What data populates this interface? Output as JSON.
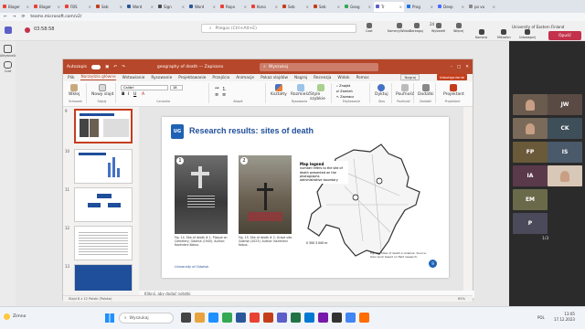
{
  "browser": {
    "tabs": [
      "Bloger",
      "Bloger",
      "FBS",
      "Seb",
      "Word",
      "Sign",
      "Word",
      "Repo",
      "Kono",
      "Seb",
      "Seb",
      "Geog",
      "Tr",
      "Prog",
      "Deep",
      "po vo"
    ],
    "url": "teams.microsoft.com/v2/"
  },
  "teams": {
    "timer": "03:58:58",
    "search_placeholder": "Pliegos (Ctrl+Alt+E)",
    "org": "University of Eastern Finland",
    "left_rail": [
      "Aktywność",
      "Czat"
    ],
    "top_buttons": [
      "Czat",
      "Kamery/Widoki",
      "Zareaguj",
      "Wyświetl",
      "Więcej",
      "Kamera",
      "Mikrofon",
      "Udostępnij"
    ],
    "people_count": "24",
    "leave_label": "Opuść"
  },
  "powerpoint": {
    "autosave": "Autozapis",
    "filename": "geography of death — Zapisano",
    "search": "Wyszukaj",
    "menu": [
      "Plik",
      "Narzędzia główne",
      "Wstawianie",
      "Rysowanie",
      "Projektowanie",
      "Przejścia",
      "Animacje",
      "Pokaz slajdów",
      "Nagraj",
      "Recenzja",
      "Widok",
      "Pomoc"
    ],
    "active_menu": "Narzędzia główne",
    "record_btn": "Nagraj",
    "share_btn": "Udostępnianie",
    "ribbon_groups": [
      "Schowek",
      "Slajdy",
      "Czcionka",
      "Akapit",
      "Rysowanie",
      "Edytowanie",
      "Głos",
      "Poufność",
      "Dodatki",
      "Projektant"
    ],
    "ribbon_buttons": [
      "Wklej",
      "Nowy slajd",
      "Kształty",
      "Rozmieść",
      "Style szybkie",
      "Znajdź",
      "Zamień",
      "Zaznacz",
      "Dyktuj",
      "Poufność",
      "Dodatki",
      "Projektant"
    ],
    "font_name": "Calibri",
    "font_size": "18",
    "notes_placeholder": "Kliknij, aby dodać notatki",
    "status": "Slajd 8 z 12   Polski (Polska)",
    "zoom": "63%"
  },
  "slide": {
    "title": "Research results: sites of death",
    "logo_text": "UG",
    "photo1_num": "1",
    "photo2_num": "2",
    "caption1": "Fig. 14. Site of death # 1. Plaque on Cemetery, Gdańsk (1945). Author: Kazimierz Kobus.",
    "caption2": "Fig. 15. Site of death # 2. Grave site. Gdańsk (2023). Author: Kazimierz Kobus.",
    "legend_title": "Map legend",
    "legend_items": [
      "number refers to the site of death presented on the photographs",
      "administrative boundary"
    ],
    "scale": "0  300  3 000 m",
    "map_caption": "Fig. 16. Sites of death in Gdańsk. Source: Own work based on field research.",
    "footer": "University of Gdańsk",
    "page_num": "9"
  },
  "thumbnails": [
    "9",
    "10",
    "11",
    "12",
    "13"
  ],
  "gallery": [
    "JW",
    "CK",
    "FP",
    "IS",
    "IA",
    "EM",
    "P"
  ],
  "gallery_page": "1/3",
  "taskbar": {
    "weather": "Zimno",
    "search": "Wyszukaj",
    "language": "POL",
    "time": "13:05",
    "date": "17.12.2023"
  }
}
